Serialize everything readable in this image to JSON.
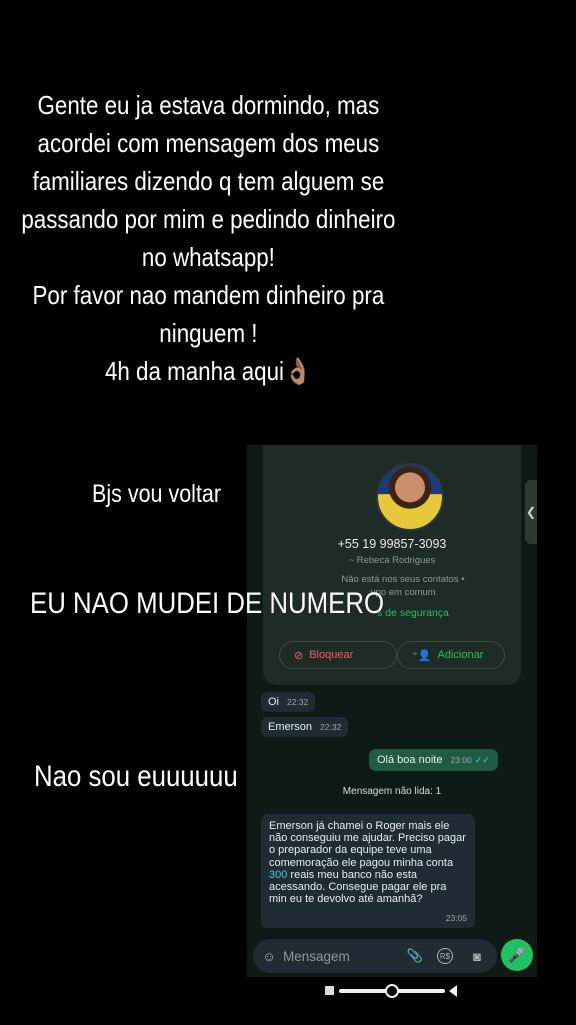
{
  "story": {
    "lines": [
      "Gente eu ja estava dormindo, mas",
      "acordei com mensagem dos meus",
      "familiares dizendo q tem alguem se",
      "passando por mim e pedindo dinheiro",
      "no whatsapp!",
      "Por favor nao mandem dinheiro pra",
      "ninguem !",
      "4h da manha aqui"
    ],
    "emoji": "👌🏽",
    "bjs": "Bjs vou voltar",
    "not_changed": "EU NAO MUDEI DE NUMERO",
    "not_me": "Nao sou euuuuuu"
  },
  "whatsapp": {
    "contact": {
      "phone": "+55 19 99857-3093",
      "name": "~ Rebeca Rodrigues",
      "info_line1": "Não está nos seus contatos •",
      "info_line2": "upo em comum",
      "security_link": "s de segurança",
      "block_label": "Bloquear",
      "add_label": "Adicionar"
    },
    "messages": [
      {
        "text": "Oi",
        "time": "22:32",
        "dir": "in"
      },
      {
        "text": "Emerson",
        "time": "22:32",
        "dir": "in"
      },
      {
        "text": "Olá boa noite",
        "time": "23:00",
        "dir": "out"
      }
    ],
    "unread_label": "Mensagem não lida: 1",
    "long_message": {
      "part1": "Emerson já chamei o Roger mais ele não conseguiu me ajudar.  Preciso pagar o preparador da equipe teve uma comemoração ele pagou minha conta ",
      "amount": "300",
      "part2": " reais meu banco não esta acessando.  Consegue pagar ele pra min eu te devolvo até amanhã?",
      "time": "23:05"
    },
    "composer_placeholder": "Mensagem"
  },
  "colors": {
    "accent_green": "#21c063",
    "block_red": "#f15c6d",
    "outgoing_bubble": "#1f5c43",
    "incoming_bubble": "#202c33"
  }
}
